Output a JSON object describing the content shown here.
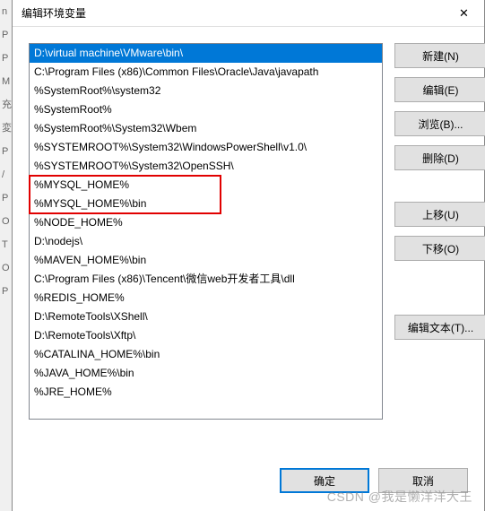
{
  "dialog": {
    "title": "编辑环境变量",
    "close_label": "✕"
  },
  "list": {
    "items": [
      "D:\\virtual machine\\VMware\\bin\\",
      "C:\\Program Files (x86)\\Common Files\\Oracle\\Java\\javapath",
      "%SystemRoot%\\system32",
      "%SystemRoot%",
      "%SystemRoot%\\System32\\Wbem",
      "%SYSTEMROOT%\\System32\\WindowsPowerShell\\v1.0\\",
      "%SYSTEMROOT%\\System32\\OpenSSH\\",
      "%MYSQL_HOME%",
      "%MYSQL_HOME%\\bin",
      "%NODE_HOME%",
      "D:\\nodejs\\",
      "%MAVEN_HOME%\\bin",
      "C:\\Program Files (x86)\\Tencent\\微信web开发者工具\\dll",
      "%REDIS_HOME%",
      "D:\\RemoteTools\\XShell\\",
      "D:\\RemoteTools\\Xftp\\",
      "%CATALINA_HOME%\\bin",
      "%JAVA_HOME%\\bin",
      "%JRE_HOME%"
    ],
    "selected_index": 0
  },
  "buttons": {
    "new": "新建(N)",
    "edit": "编辑(E)",
    "browse": "浏览(B)...",
    "delete": "删除(D)",
    "move_up": "上移(U)",
    "move_down": "下移(O)",
    "edit_text": "编辑文本(T)...",
    "ok": "确定",
    "cancel": "取消"
  },
  "watermark": "CSDN @我是懒洋洋大王",
  "bg": [
    "n",
    "",
    "P",
    "",
    "",
    "P",
    "",
    "M",
    "",
    "",
    "",
    "充",
    "",
    "変",
    "",
    "P",
    "/",
    "P",
    "O",
    "T",
    "O",
    "",
    "",
    "",
    "P"
  ]
}
